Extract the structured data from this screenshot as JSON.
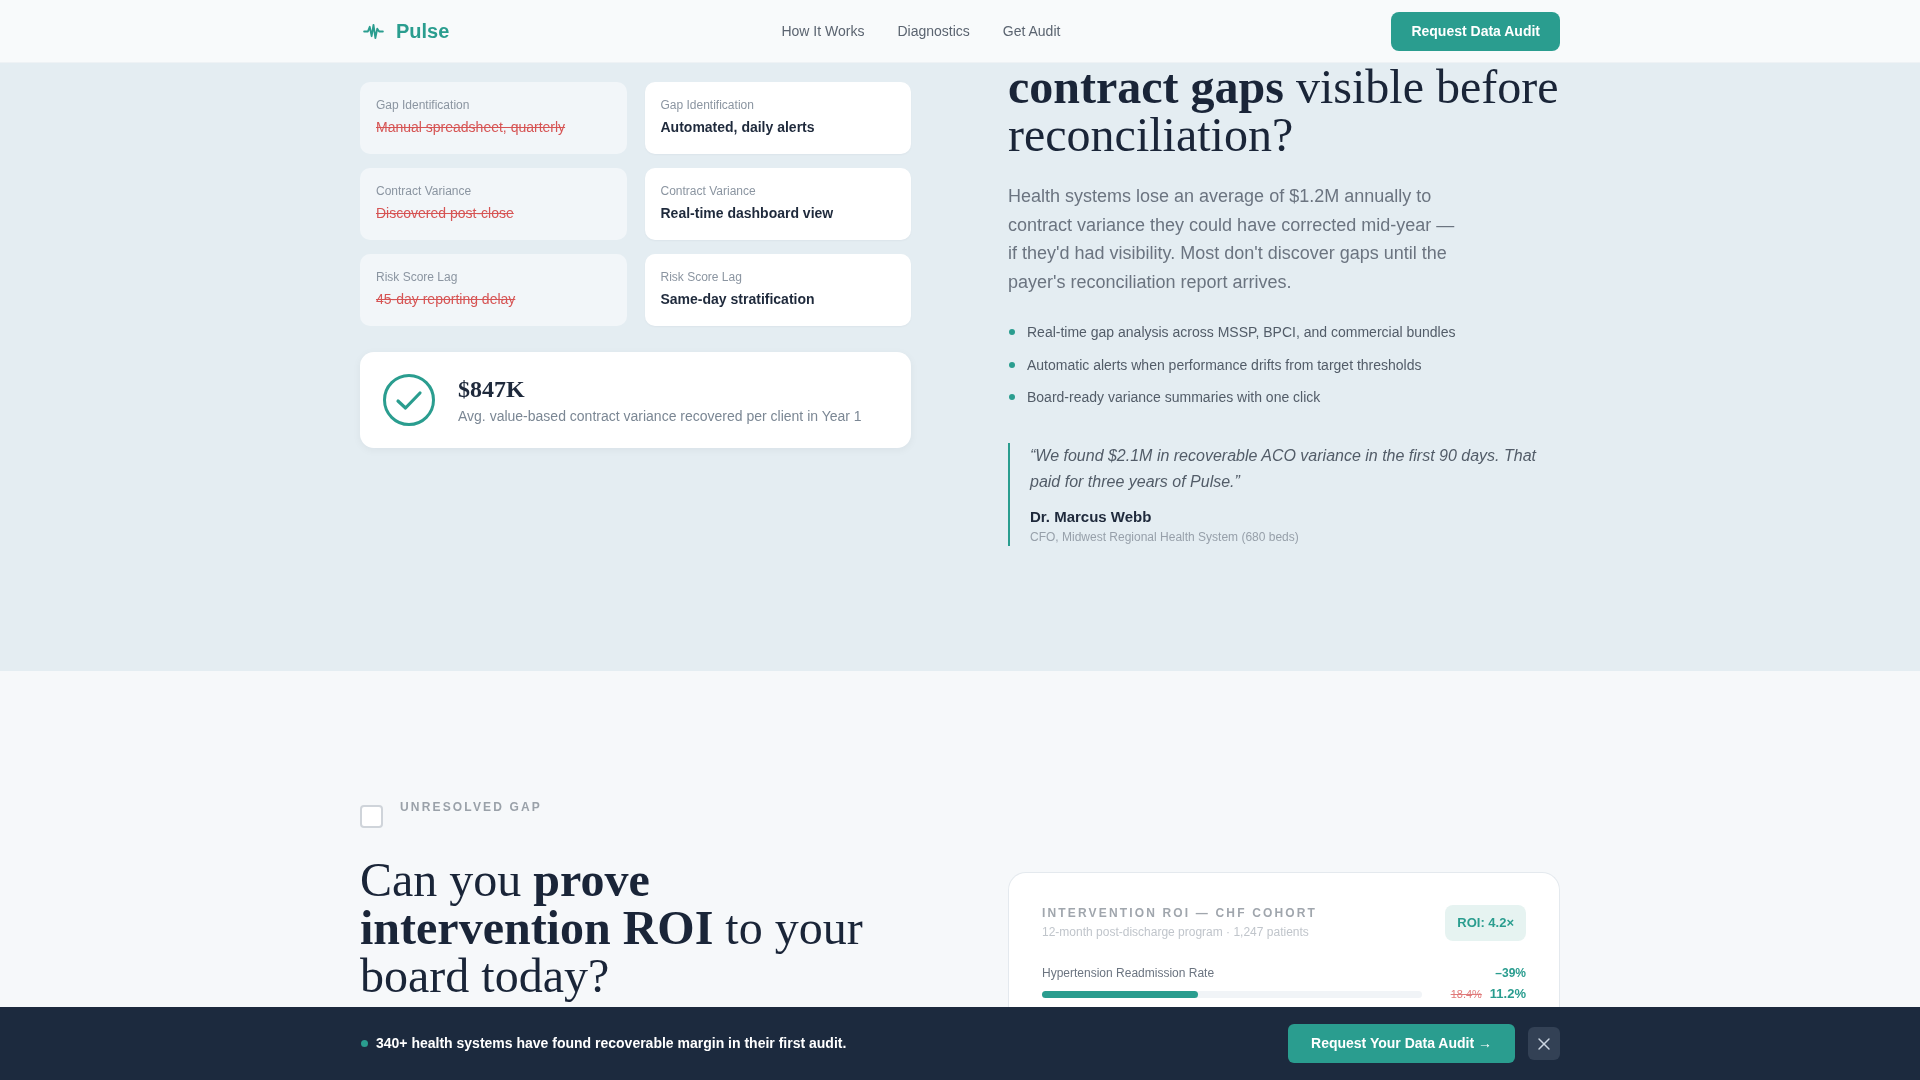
{
  "header": {
    "logo": "Pulse",
    "nav": [
      "How It Works",
      "Diagnostics",
      "Get Audit"
    ],
    "cta": "Request Data Audit"
  },
  "comparison": {
    "cards": [
      {
        "kind": "before",
        "label": "Gap Identification",
        "value": "Manual spreadsheet, quarterly"
      },
      {
        "kind": "after",
        "label": "Gap Identification",
        "value": "Automated, daily alerts"
      },
      {
        "kind": "before",
        "label": "Contract Variance",
        "value": "Discovered post-close"
      },
      {
        "kind": "after",
        "label": "Contract Variance",
        "value": "Real-time dashboard view"
      },
      {
        "kind": "before",
        "label": "Risk Score Lag",
        "value": "45-day reporting delay"
      },
      {
        "kind": "after",
        "label": "Risk Score Lag",
        "value": "Same-day stratification"
      }
    ],
    "stat": {
      "value": "$847K",
      "caption": "Avg. value-based contract variance recovered per client in Year 1"
    }
  },
  "intro": {
    "heading": "**contract gaps** visible before reconciliation?",
    "body": "Health systems lose an average of $1.2M annually to contract variance they could have corrected mid-year — if they'd had visibility. Most don't discover gaps until the payer's reconciliation report arrives.",
    "bullets": [
      "Real-time gap analysis across MSSP, BPCI, and commercial bundles",
      "Automatic alerts when performance drifts from target thresholds",
      "Board-ready variance summaries with one click"
    ],
    "quote": {
      "text": "“We found $2.1M in recoverable ACO variance in the first 90 days. That paid for three years of Pulse.”",
      "name": "Dr. Marcus Webb",
      "role": "CFO, Midwest Regional Health System (680 beds)"
    }
  },
  "roi_section": {
    "checkbox": {
      "label": "UNRESOLVED GAP",
      "checked": false
    },
    "heading": "Can you **prove intervention ROI** to your board today?",
    "card": {
      "title": "INTERVENTION ROI — CHF COHORT",
      "subtitle": "12-month post-discharge program · 1,247 patients",
      "badge": "ROI: 4.2×",
      "metrics": [
        {
          "label": "Hypertension Readmission Rate",
          "change": "–39%",
          "before": "18.4%",
          "after": "11.2%",
          "level": 0.41
        }
      ]
    }
  },
  "bottom_bar": {
    "message": "340+ health systems have found recoverable margin in their first audit.",
    "cta": "Request Your Data Audit →"
  }
}
